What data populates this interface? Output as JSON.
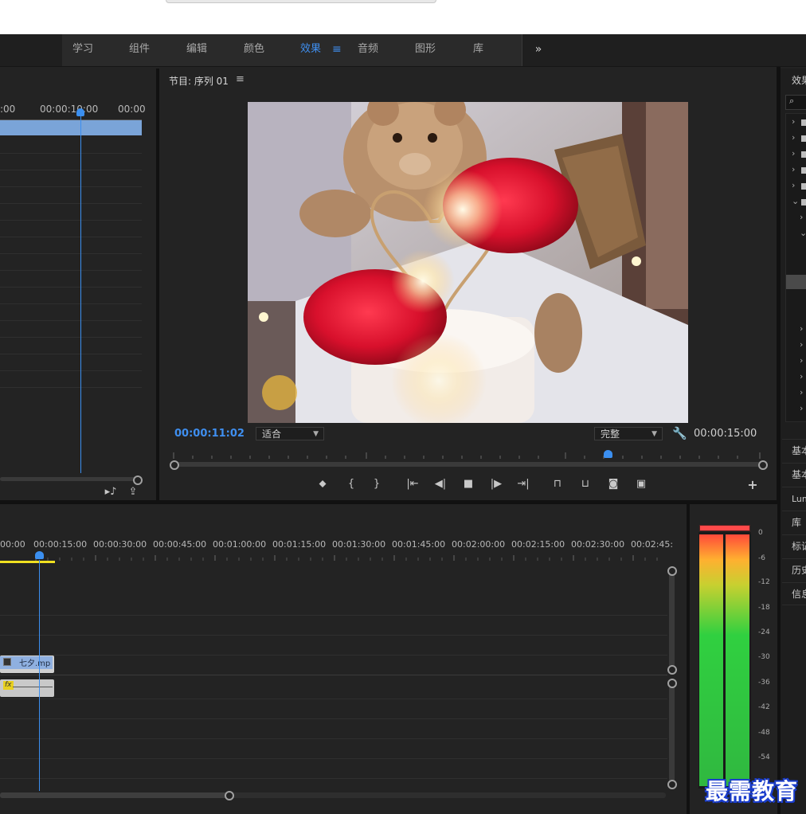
{
  "workspace_tabs": [
    {
      "label": "学习"
    },
    {
      "label": "组件"
    },
    {
      "label": "编辑"
    },
    {
      "label": "颜色"
    },
    {
      "label": "效果"
    },
    {
      "label": "音频"
    },
    {
      "label": "图形"
    },
    {
      "label": "库"
    }
  ],
  "more_glyph": "»",
  "active_tab_menu_glyph": "≡",
  "source_monitor": {
    "ruler_labels": [
      ":00",
      "00:00:10:00",
      "00:00"
    ]
  },
  "program_monitor": {
    "title": "节目: 序列 01",
    "menu_glyph": "≡",
    "current_time": "00:00:11:02",
    "fit_option": "适合",
    "quality_option": "完整",
    "duration": "00:00:15:00"
  },
  "effects_panel": {
    "title": "效果"
  },
  "side_panels": [
    "基本",
    "基本",
    "Lum",
    "库",
    "标记",
    "历史",
    "信息"
  ],
  "timeline": {
    "ruler_labels": [
      "00:00",
      "00:00:15:00",
      "00:00:30:00",
      "00:00:45:00",
      "00:01:00:00",
      "00:01:15:00",
      "00:01:30:00",
      "00:01:45:00",
      "00:02:00:00",
      "00:02:15:00",
      "00:02:30:00",
      "00:02:45:"
    ],
    "video_clip_name": "七夕.mp",
    "fx_badge": "fx"
  },
  "audio_meter": {
    "labels": [
      "0",
      "-6",
      "-12",
      "-18",
      "-24",
      "-30",
      "-36",
      "-42",
      "-48",
      "-54"
    ]
  },
  "watermark": "最需教育",
  "colors": {
    "accent": "#3f8ff0",
    "clip_video": "#8fb0e0",
    "work_area": "#f0e020"
  }
}
